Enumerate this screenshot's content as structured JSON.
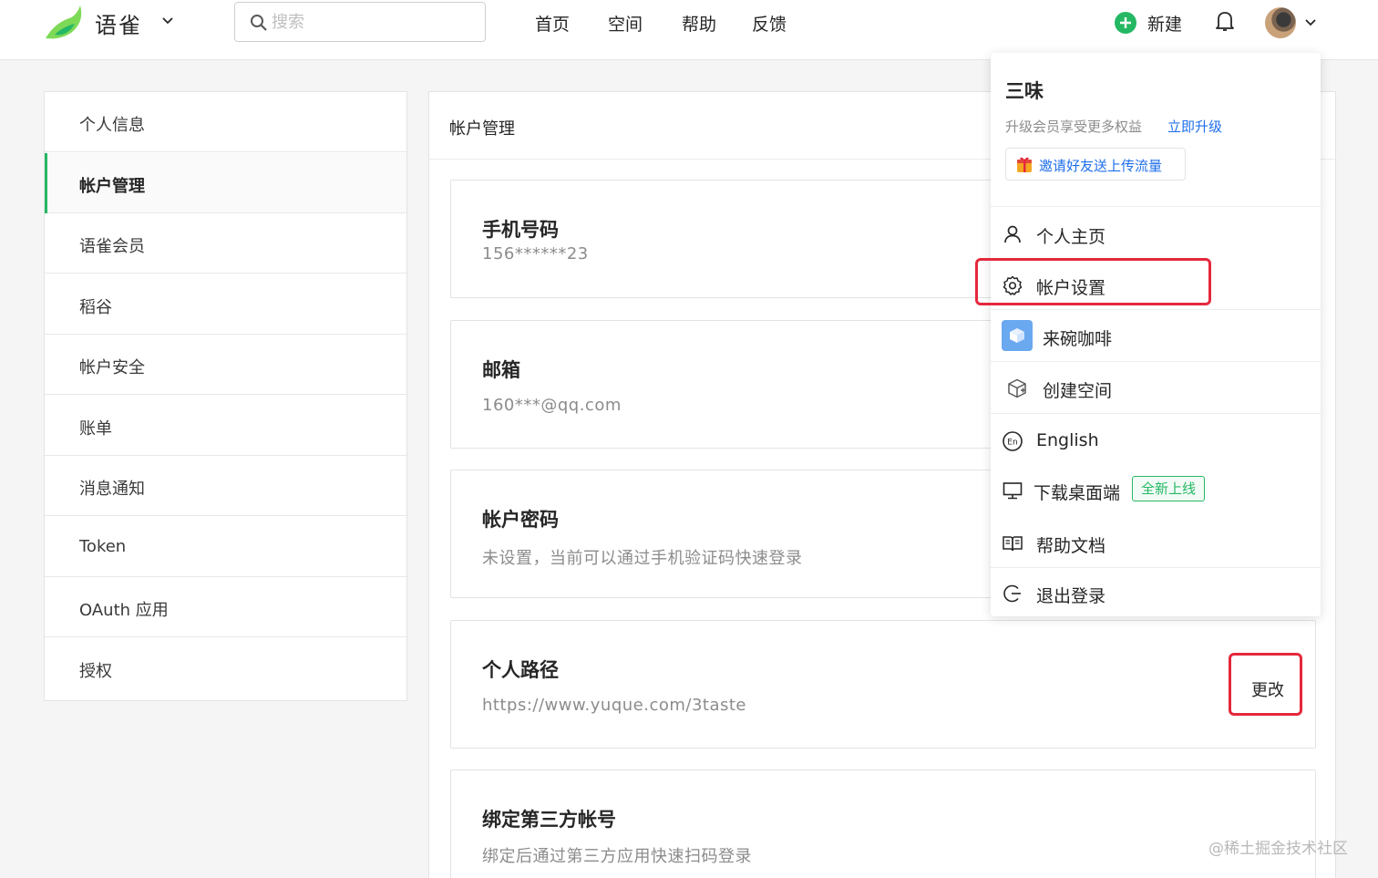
{
  "header": {
    "brand": "语雀",
    "search_placeholder": "搜索",
    "nav": [
      "首页",
      "空间",
      "帮助",
      "反馈"
    ],
    "new_label": "新建"
  },
  "sidebar": {
    "items": [
      {
        "label": "个人信息",
        "active": false
      },
      {
        "label": "帐户管理",
        "active": true
      },
      {
        "label": "语雀会员",
        "active": false
      },
      {
        "label": "稻谷",
        "active": false
      },
      {
        "label": "帐户安全",
        "active": false
      },
      {
        "label": "账单",
        "active": false
      },
      {
        "label": "消息通知",
        "active": false
      },
      {
        "label": "Token",
        "active": false
      },
      {
        "label": "OAuth 应用",
        "active": false
      },
      {
        "label": "授权",
        "active": false
      }
    ]
  },
  "main": {
    "title": "帐户管理",
    "cards": [
      {
        "title": "手机号码",
        "value": "156******23"
      },
      {
        "title": "邮箱",
        "value": "160***@qq.com"
      },
      {
        "title": "帐户密码",
        "value": "未设置，当前可以通过手机验证码快速登录"
      },
      {
        "title": "个人路径",
        "value": "https://www.yuque.com/3taste",
        "action": "更改"
      },
      {
        "title": "绑定第三方帐号",
        "value": "绑定后通过第三方应用快速扫码登录"
      }
    ]
  },
  "dropdown": {
    "name": "三味",
    "upgrade_text": "升级会员享受更多权益",
    "upgrade_link": "立即升级",
    "invite": "邀请好友送上传流量",
    "items": {
      "profile": "个人主页",
      "settings": "帐户设置",
      "space": "来碗咖啡",
      "create_space": "创建空间",
      "language": "English",
      "download": "下载桌面端",
      "download_badge": "全新上线",
      "help": "帮助文档",
      "logout": "退出登录"
    }
  },
  "watermark": "@稀土掘金技术社区",
  "colors": {
    "accent_green": "#25b864",
    "link_blue": "#1f6feb",
    "highlight_red": "#e5283c"
  }
}
